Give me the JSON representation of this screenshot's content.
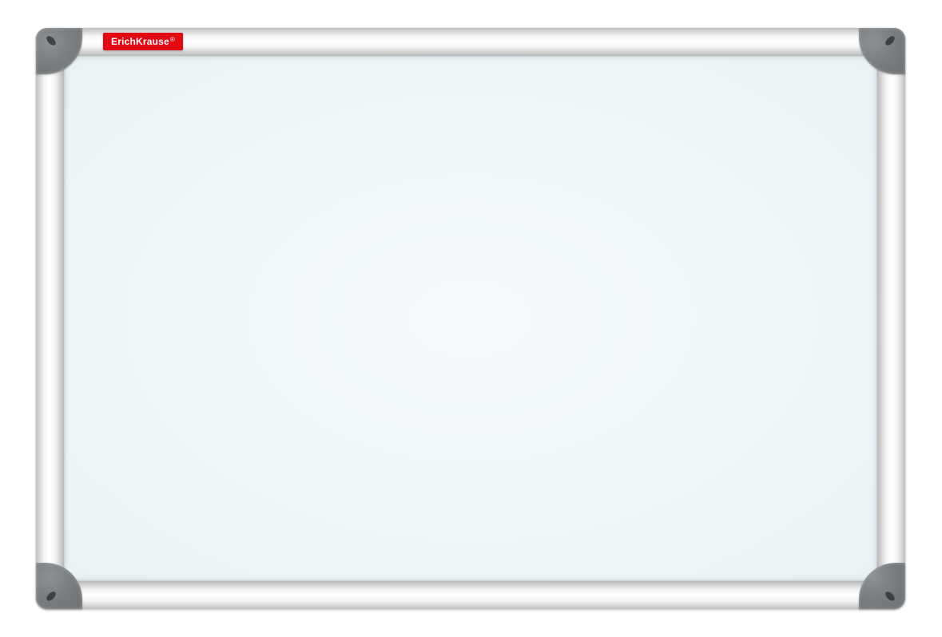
{
  "product": {
    "brand_label": "ErichKrause",
    "brand_badge_color": "#e30613"
  }
}
